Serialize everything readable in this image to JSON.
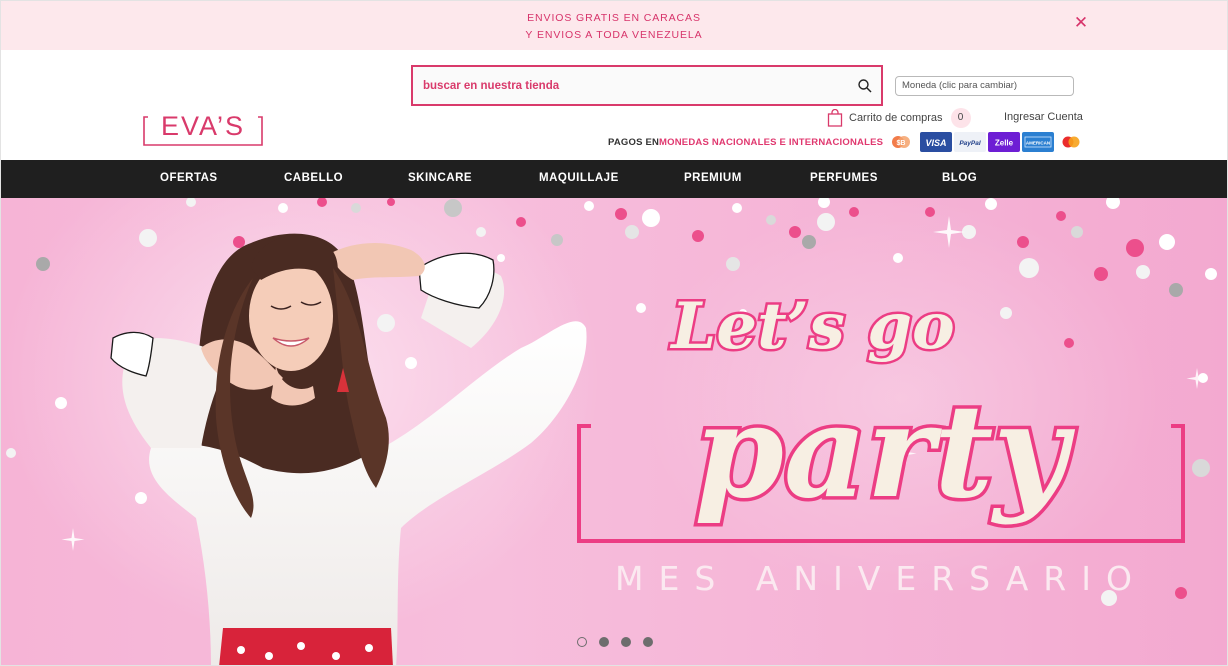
{
  "announcement": {
    "line1": "ENVIOS GRATIS EN CARACAS",
    "line2": "Y ENVIOS A TODA VENEZUELA",
    "close_icon": "close-icon",
    "color": "#d7336a",
    "background": "#fde8ec"
  },
  "logo": {
    "text": "EVA’S",
    "color": "#d93a6b"
  },
  "search": {
    "placeholder": "buscar en nuestra tienda",
    "value": "",
    "icon": "search-icon"
  },
  "currency": {
    "label": "Moneda (clic para cambiar)"
  },
  "cart": {
    "label": "Carrito de compras",
    "count": "0",
    "icon": "shopping-bag-icon"
  },
  "account": {
    "login_label": "Ingresar Cuenta"
  },
  "payments": {
    "prefix": "PAGOS EN ",
    "highlight": "MONEDAS NACIONALES E INTERNACIONALES",
    "methods": [
      "Binance",
      "VISA",
      "PayPal",
      "Zelle",
      "American Express",
      "Mastercard"
    ]
  },
  "nav": {
    "items": [
      "OFERTAS",
      "CABELLO",
      "SKINCARE",
      "MAQUILLAJE",
      "PREMIUM",
      "PERFUMES",
      "BLOG"
    ]
  },
  "hero": {
    "line1": "Let’s go",
    "line2": "party",
    "subtitle": "MES ANIVERSARIO",
    "slide_count": 4,
    "active_slide": 1,
    "colors": {
      "pink": "#ec3d84",
      "cream": "#f7efe3",
      "background": "#f5b3d6"
    }
  },
  "colors": {
    "accent": "#d93a6b",
    "nav_bg": "#1f1f1f"
  }
}
